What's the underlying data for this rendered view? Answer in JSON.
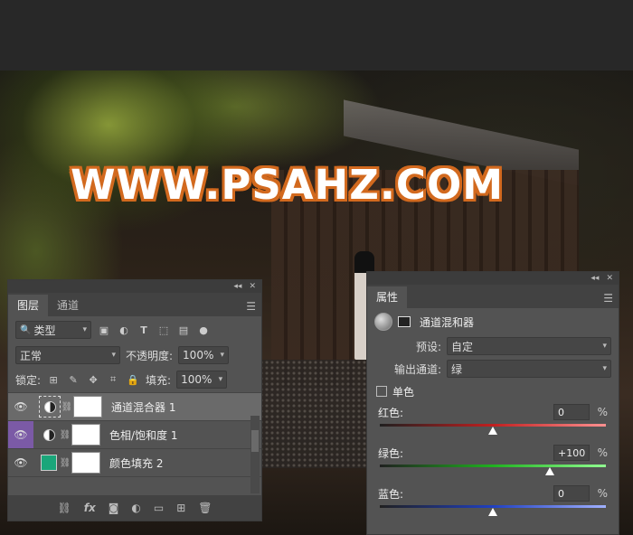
{
  "watermark": "WWW.PSAHZ.COM",
  "layers_panel": {
    "tabs": [
      "图层",
      "通道"
    ],
    "kind_filter": "类型",
    "blend_mode": "正常",
    "opacity_label": "不透明度:",
    "opacity_value": "100%",
    "lock_label": "锁定:",
    "fill_label": "填充:",
    "fill_value": "100%",
    "layers": [
      {
        "name": "通道混合器 1",
        "selected": true
      },
      {
        "name": "色相/饱和度 1",
        "selected": false
      },
      {
        "name": "颜色填充 2",
        "selected": false,
        "fill_color": "#1aa67a"
      }
    ],
    "footer_fx": "fx"
  },
  "properties_panel": {
    "tab": "属性",
    "title": "通道混和器",
    "preset_label": "预设:",
    "preset_value": "自定",
    "output_label": "输出通道:",
    "output_value": "绿",
    "mono_label": "单色",
    "sliders": [
      {
        "label": "红色:",
        "value": "0",
        "pct": "%",
        "position": 0.5,
        "color": "#c02020"
      },
      {
        "label": "绿色:",
        "value": "+100",
        "pct": "%",
        "position": 0.75,
        "color": "#20b020"
      },
      {
        "label": "蓝色:",
        "value": "0",
        "pct": "%",
        "position": 0.5,
        "color": "#2040c0"
      }
    ]
  }
}
